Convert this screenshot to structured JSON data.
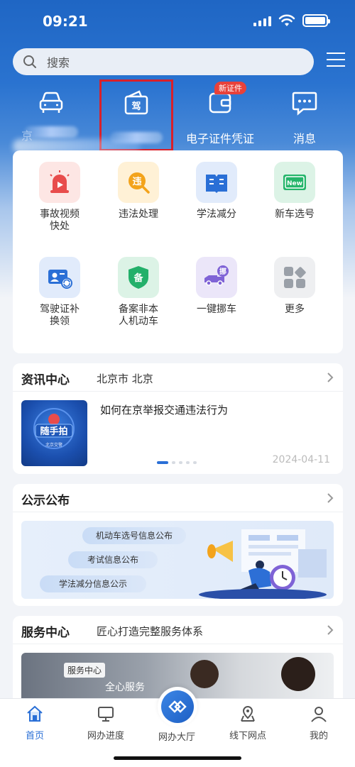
{
  "status": {
    "time": "09:21"
  },
  "search": {
    "placeholder": "搜索"
  },
  "quick": {
    "car_label": "京",
    "license_icon_text": "驾",
    "ecert_label": "电子证件凭证",
    "ecert_badge": "新证件",
    "message_label": "消息"
  },
  "services": {
    "items": [
      {
        "label": "事故视频快处",
        "icon": "alarm-video-icon",
        "color": "#e84c4c"
      },
      {
        "label": "违法处理",
        "icon_text": "违",
        "icon": "violation-search-icon",
        "color": "#f3a31b"
      },
      {
        "label": "学法减分",
        "icon": "book-icon",
        "color": "#2a6fd6"
      },
      {
        "label": "新车选号",
        "icon_text": "New",
        "icon": "new-plate-icon",
        "color": "#24b56a"
      },
      {
        "label": "驾驶证补换领",
        "icon": "license-renew-icon",
        "color": "#2a6fd6"
      },
      {
        "label": "备案非本人机动车",
        "icon_text": "备",
        "icon": "shield-record-icon",
        "color": "#23b06a"
      },
      {
        "label": "一键挪车",
        "icon_text": "挪",
        "icon": "move-truck-icon",
        "color": "#7f63d6"
      },
      {
        "label": "更多",
        "icon": "more-grid-icon",
        "color": "#9aa0a8"
      }
    ]
  },
  "news": {
    "title": "资讯中心",
    "location": "北京市 北京",
    "headline": "如何在京举报交通违法行为",
    "date": "2024-04-11",
    "thumb_text": "随手拍",
    "thumb_sub": "北京交警"
  },
  "notice": {
    "title": "公示公布",
    "pills": [
      "机动车选号信息公布",
      "考试信息公布",
      "学法减分信息公示"
    ]
  },
  "service_center": {
    "title": "服务中心",
    "subtitle": "匠心打造完整服务体系",
    "tag": "服务中心",
    "tagline": "全心服务"
  },
  "tabbar": {
    "items": [
      "首页",
      "网办进度",
      "网办大厅",
      "线下网点",
      "我的"
    ]
  },
  "colors": {
    "primary": "#2a6fd6",
    "highlight": "#d9202a",
    "badge": "#e8413a"
  }
}
